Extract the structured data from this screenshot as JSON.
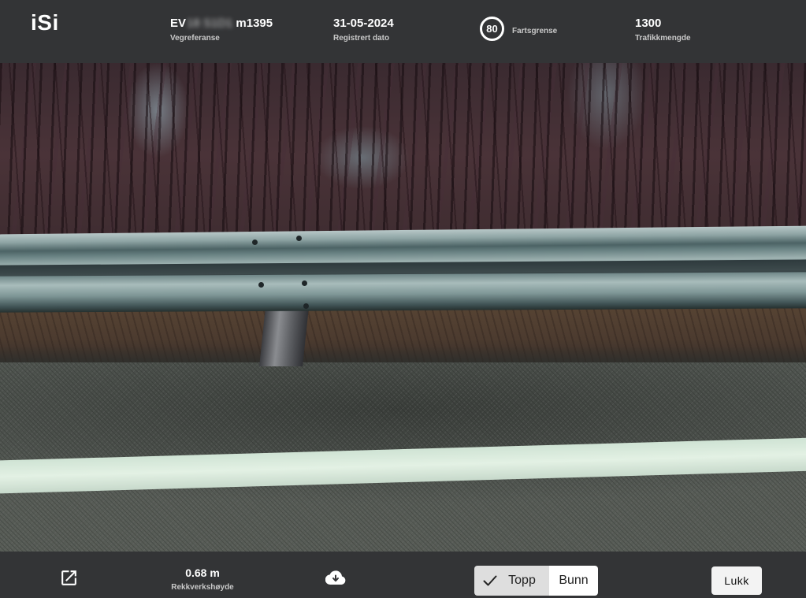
{
  "header": {
    "logo": "iSi",
    "road_reference": {
      "prefix": "EV",
      "hidden_part": "18 S1D1",
      "suffix": "m1395",
      "label": "Vegreferanse"
    },
    "registered_date": {
      "value": "31-05-2024",
      "label": "Registrert dato"
    },
    "speed_limit": {
      "value": "80",
      "label": "Fartsgrense"
    },
    "traffic": {
      "value": "1300",
      "label": "Trafikkmengde"
    }
  },
  "footer": {
    "open_external_icon": "external-link-icon",
    "rail_height": {
      "value": "0.68 m",
      "label": "Rekkverkshøyde"
    },
    "download_icon": "cloud-download-icon",
    "position_toggle": {
      "options": [
        "Topp",
        "Bunn"
      ],
      "selected": "Topp"
    },
    "close_label": "Lukk"
  },
  "colors": {
    "bar_background": "#333436",
    "selected_segment": "#dedede",
    "text": "#ffffff"
  }
}
